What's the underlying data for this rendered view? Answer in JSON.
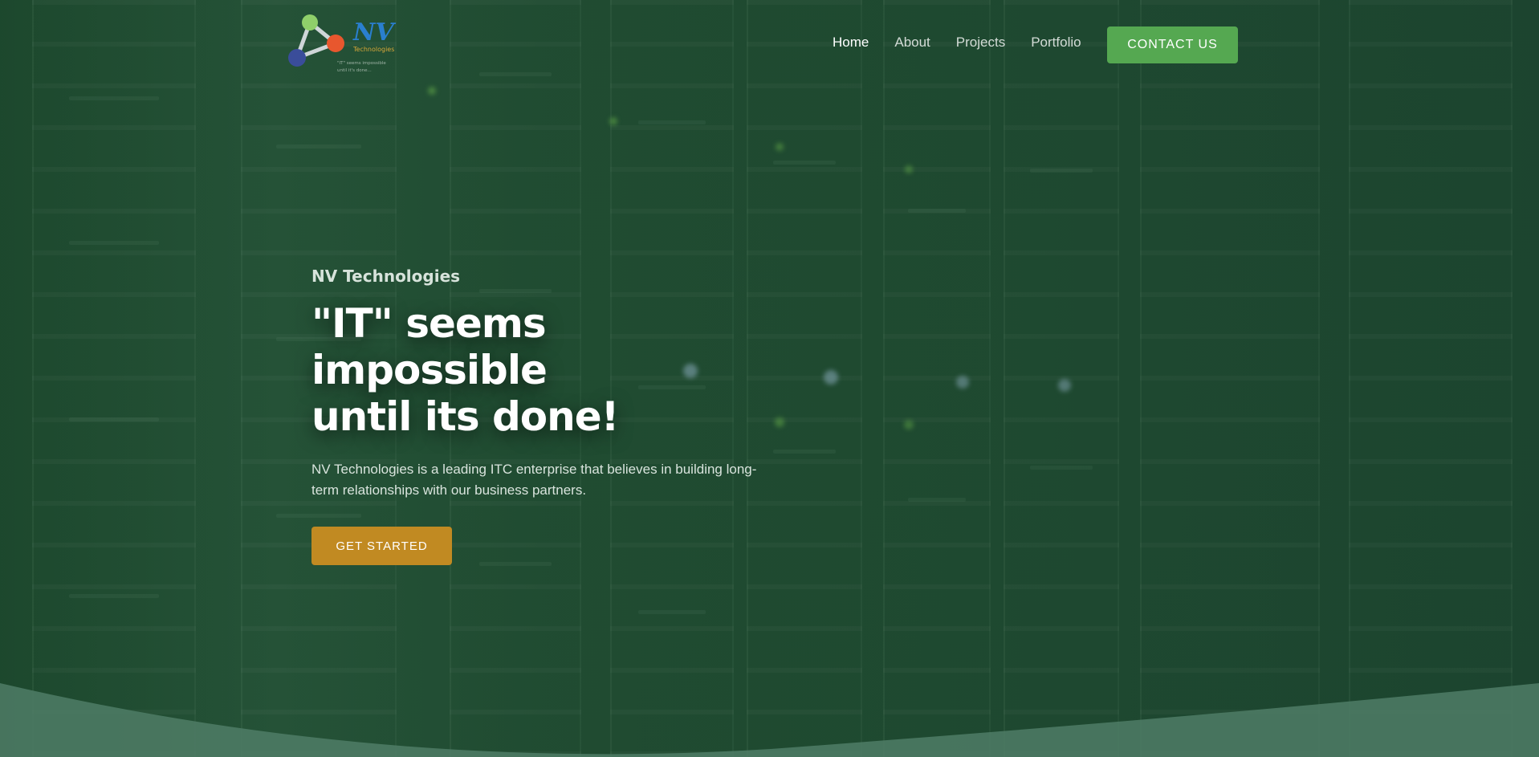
{
  "brand": {
    "logo_icon": "molecule-logo-icon",
    "logo_wordmark": "NV",
    "logo_tagline_1": "Technologies",
    "logo_tagline_2": "\"IT\" seems impossible",
    "logo_tagline_3": "until it's done..."
  },
  "nav": {
    "items": [
      {
        "label": "Home",
        "active": true
      },
      {
        "label": "About",
        "active": false
      },
      {
        "label": "Projects",
        "active": false
      },
      {
        "label": "Portfolio",
        "active": false
      }
    ],
    "contact_label": "CONTACT US"
  },
  "hero": {
    "eyebrow": "NV Technologies",
    "headline_line1": "\"IT\" seems impossible",
    "headline_line2": "until its done!",
    "description": "NV Technologies is a leading ITC enterprise that believes in building long-term relationships with our business partners.",
    "cta_label": "GET STARTED"
  },
  "colors": {
    "background": "#234f35",
    "contact_button": "#55a851",
    "cta_button": "#c18a22",
    "wave": "#4f7c66"
  }
}
